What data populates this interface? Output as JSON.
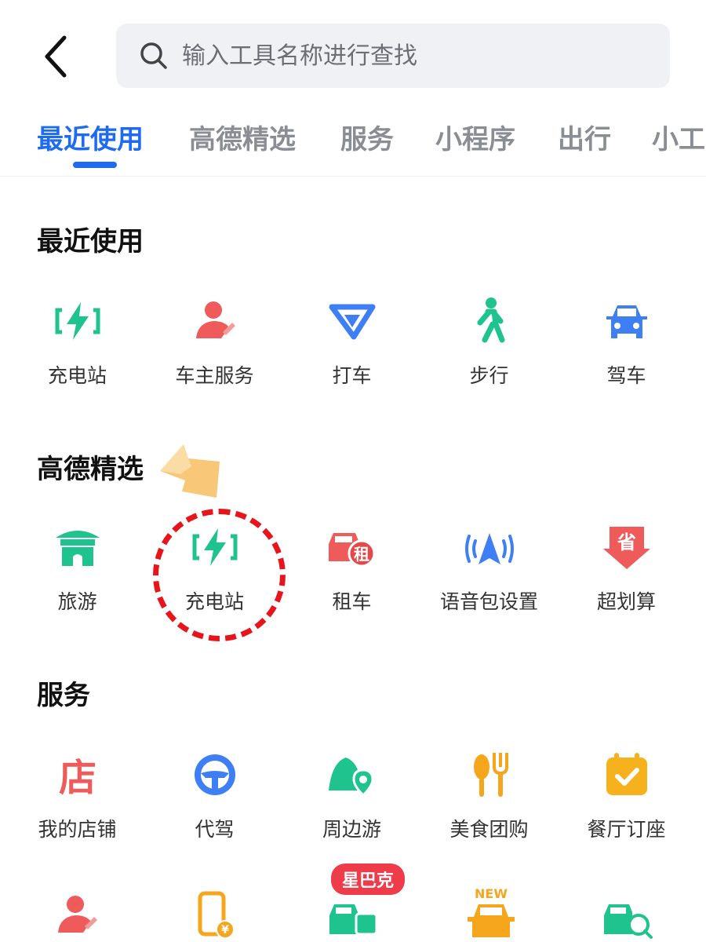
{
  "search": {
    "placeholder": "输入工具名称进行查找"
  },
  "tabs": [
    {
      "label": "最近使用",
      "active": true
    },
    {
      "label": "高德精选",
      "active": false
    },
    {
      "label": "服务",
      "active": false
    },
    {
      "label": "小程序",
      "active": false
    },
    {
      "label": "出行",
      "active": false
    },
    {
      "label": "小工",
      "active": false
    }
  ],
  "sections": {
    "recent": {
      "title": "最近使用",
      "items": [
        {
          "label": "充电站",
          "icon": "charging-station-icon"
        },
        {
          "label": "车主服务",
          "icon": "car-owner-service-icon"
        },
        {
          "label": "打车",
          "icon": "taxi-icon"
        },
        {
          "label": "步行",
          "icon": "walking-icon"
        },
        {
          "label": "驾车",
          "icon": "driving-icon"
        }
      ]
    },
    "featured": {
      "title": "高德精选",
      "items": [
        {
          "label": "旅游",
          "icon": "travel-icon"
        },
        {
          "label": "充电站",
          "icon": "charging-station-icon"
        },
        {
          "label": "租车",
          "icon": "car-rental-icon",
          "badge_text": "租"
        },
        {
          "label": "语音包设置",
          "icon": "voice-pack-icon"
        },
        {
          "label": "超划算",
          "icon": "super-deal-icon",
          "badge_text": "省"
        }
      ]
    },
    "services": {
      "title": "服务",
      "items": [
        {
          "label": "我的店铺",
          "icon": "my-store-icon",
          "badge_text": "店"
        },
        {
          "label": "代驾",
          "icon": "designated-driver-icon"
        },
        {
          "label": "周边游",
          "icon": "nearby-travel-icon"
        },
        {
          "label": "美食团购",
          "icon": "food-group-buy-icon"
        },
        {
          "label": "餐厅订座",
          "icon": "restaurant-booking-icon"
        }
      ],
      "row2_badge": "星巴克",
      "row2_new_tag": "NEW"
    }
  },
  "colors": {
    "accent": "#1f6bf0",
    "green": "#1fc38d",
    "red": "#ef5b5b",
    "blue": "#3f7ff5",
    "orange": "#f6a61c",
    "annotation": "#e8141c"
  }
}
